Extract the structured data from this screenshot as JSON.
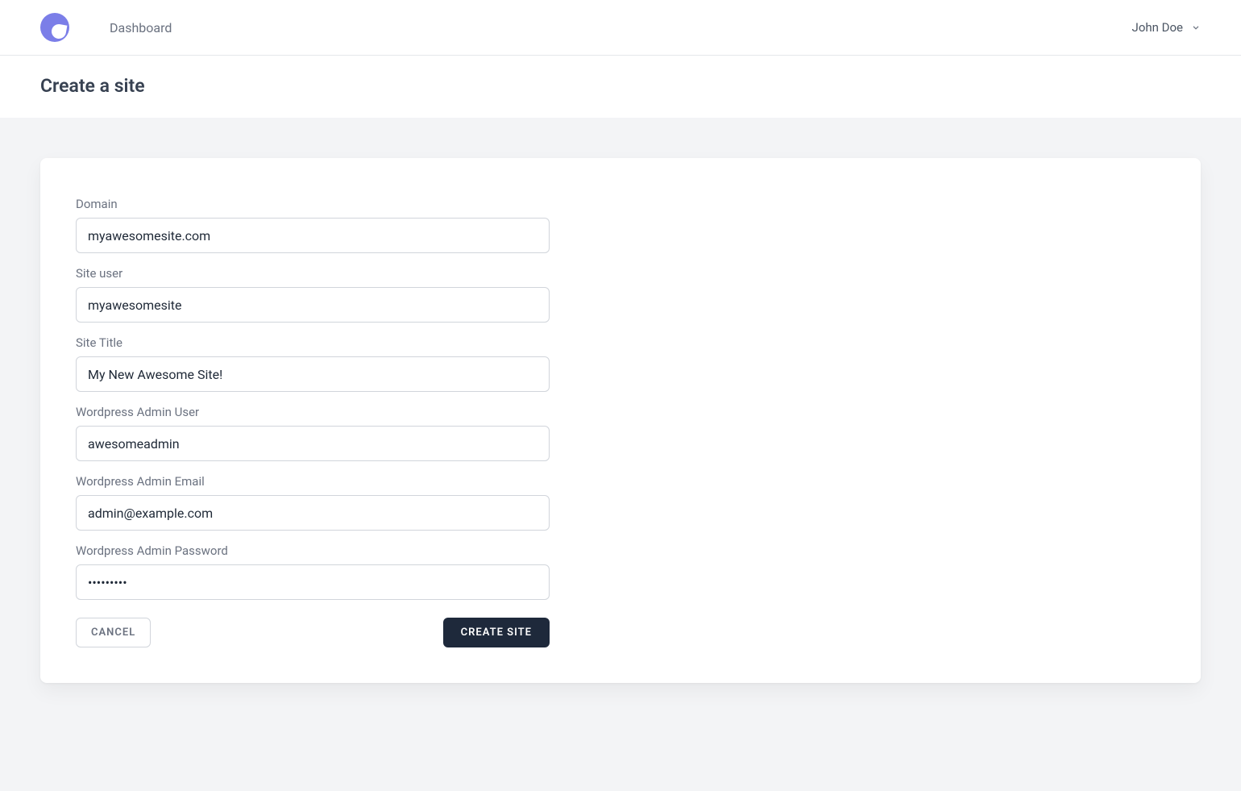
{
  "header": {
    "nav_dashboard": "Dashboard",
    "user_name": "John Doe"
  },
  "page": {
    "title": "Create a site"
  },
  "form": {
    "domain": {
      "label": "Domain",
      "value": "myawesomesite.com"
    },
    "site_user": {
      "label": "Site user",
      "value": "myawesomesite"
    },
    "site_title": {
      "label": "Site Title",
      "value": "My New Awesome Site!"
    },
    "wp_admin_user": {
      "label": "Wordpress Admin User",
      "value": "awesomeadmin"
    },
    "wp_admin_email": {
      "label": "Wordpress Admin Email",
      "value": "admin@example.com"
    },
    "wp_admin_password": {
      "label": "Wordpress Admin Password",
      "value": "•••••••••"
    },
    "buttons": {
      "cancel": "CANCEL",
      "submit": "CREATE SITE"
    }
  }
}
